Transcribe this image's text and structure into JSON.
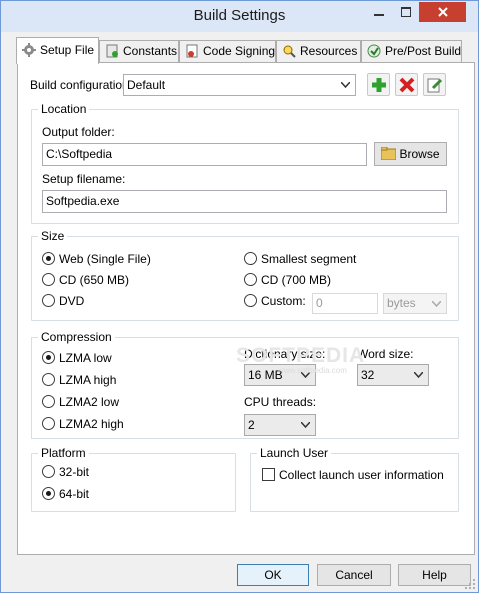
{
  "window": {
    "title": "Build Settings"
  },
  "tabs": [
    {
      "label": "Setup File",
      "icon": "gear-icon"
    },
    {
      "label": "Constants",
      "icon": "constants-icon"
    },
    {
      "label": "Code Signing",
      "icon": "certificate-icon"
    },
    {
      "label": "Resources",
      "icon": "resources-icon"
    },
    {
      "label": "Pre/Post Build",
      "icon": "build-icon"
    }
  ],
  "build_config": {
    "label": "Build configuration:",
    "value": "Default"
  },
  "location": {
    "title": "Location",
    "output_folder_label": "Output folder:",
    "output_folder_value": "C:\\Softpedia",
    "browse_label": "Browse",
    "setup_filename_label": "Setup filename:",
    "setup_filename_value": "Softpedia.exe"
  },
  "size": {
    "title": "Size",
    "options": [
      "Web (Single File)",
      "CD (650 MB)",
      "DVD",
      "Smallest segment",
      "CD (700 MB)",
      "Custom:"
    ],
    "selected": "Web (Single File)",
    "custom_value": "0",
    "custom_unit": "bytes"
  },
  "compression": {
    "title": "Compression",
    "options": [
      "LZMA low",
      "LZMA high",
      "LZMA2 low",
      "LZMA2 high"
    ],
    "selected": "LZMA low",
    "dictionary_label": "Dictionary size:",
    "dictionary_value": "16 MB",
    "word_label": "Word size:",
    "word_value": "32",
    "threads_label": "CPU threads:",
    "threads_value": "2"
  },
  "watermark": {
    "text": "SOFTPEDIA",
    "sub": "www.softpedia.com"
  },
  "platform": {
    "title": "Platform",
    "options": [
      "32-bit",
      "64-bit"
    ],
    "selected": "64-bit"
  },
  "launch_user": {
    "title": "Launch User",
    "checkbox_label": "Collect launch user information",
    "checked": false
  },
  "footer": {
    "ok": "OK",
    "cancel": "Cancel",
    "help": "Help"
  },
  "colors": {
    "close_button": "#c7402f",
    "titlebar": "#dbe7f7",
    "add_icon": "#2ea12e",
    "remove_icon": "#d42020"
  }
}
